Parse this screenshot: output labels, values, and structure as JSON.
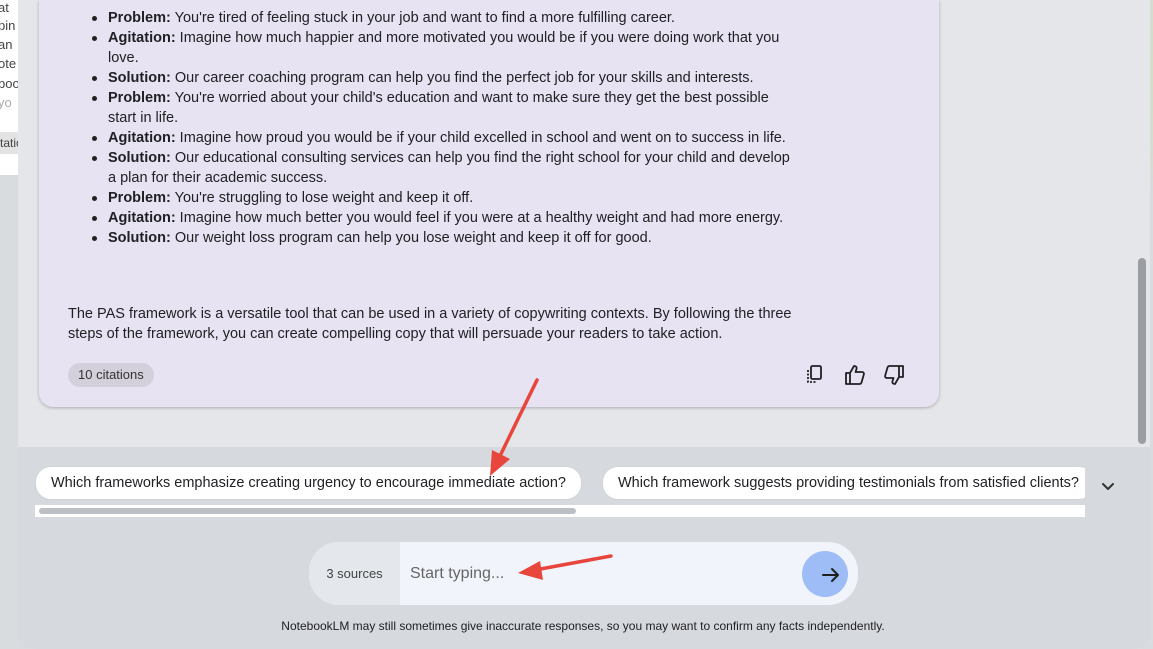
{
  "left_panel": {
    "fragments": [
      "at",
      "pin",
      "an",
      "ote",
      "boo",
      "yo"
    ],
    "chip_label": "tatio"
  },
  "response": {
    "bullets": [
      {
        "label": "Problem:",
        "text": " You're tired of feeling stuck in your job and want to find a more fulfilling career."
      },
      {
        "label": "Agitation:",
        "text": " Imagine how much happier and more motivated you would be if you were doing work that you love."
      },
      {
        "label": "Solution:",
        "text": " Our career coaching program can help you find the perfect job for your skills and interests."
      },
      {
        "label": "Problem:",
        "text": " You're worried about your child's education and want to make sure they get the best possible start in life."
      },
      {
        "label": "Agitation:",
        "text": " Imagine how proud you would be if your child excelled in school and went on to success in life."
      },
      {
        "label": "Solution:",
        "text": " Our educational consulting services can help you find the right school for your child and develop a plan for their academic success."
      },
      {
        "label": "Problem:",
        "text": " You're struggling to lose weight and keep it off."
      },
      {
        "label": "Agitation:",
        "text": " Imagine how much better you would feel if you were at a healthy weight and had more energy."
      },
      {
        "label": "Solution:",
        "text": " Our weight loss program can help you lose weight and keep it off for good."
      }
    ],
    "summary": "The PAS framework is a versatile tool that can be used in a variety of copywriting contexts. By following the three steps of the framework, you can create compelling copy that will persuade your readers to take action.",
    "citations_label": "10 citations",
    "actions": [
      "copy-icon",
      "thumbs-up-icon",
      "thumbs-down-icon"
    ]
  },
  "suggestions": [
    "Which frameworks emphasize creating urgency to encourage immediate action?",
    "Which framework suggests providing testimonials from satisfied clients?"
  ],
  "composer": {
    "sources_label": "3 sources",
    "placeholder": "Start typing...",
    "send_icon": "arrow-right-icon"
  },
  "disclaimer": "NotebookLM may still sometimes give inaccurate responses, so you may want to confirm any facts independently.",
  "colors": {
    "card_bg": "#e7e3f2",
    "send_button": "#9ebcf6",
    "annotation_arrow": "#e8453c"
  }
}
